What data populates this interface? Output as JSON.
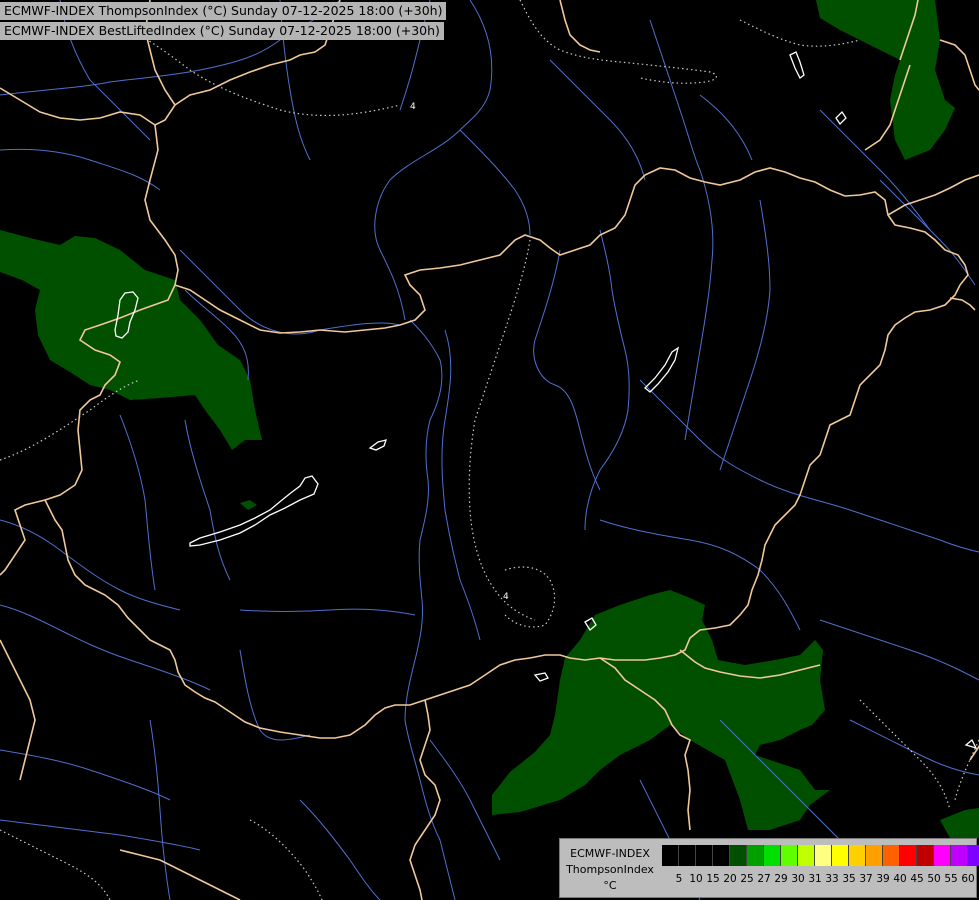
{
  "title_line1": "ECMWF-INDEX ThompsonIndex (°C) Sunday 07-12-2025 18:00 (+30h)",
  "title_line2": "ECMWF-INDEX BestLiftedIndex (°C) Sunday 07-12-2025 18:00 (+30h)",
  "contour_labels": [
    "4",
    "4"
  ],
  "legend": {
    "line1": "ECMWF-INDEX",
    "line2": "ThompsonIndex",
    "line3": "°C",
    "colors": [
      "#000000",
      "#000000",
      "#000000",
      "#000000",
      "#005000",
      "#00a000",
      "#00e000",
      "#60ff00",
      "#c0ff00",
      "#ffff80",
      "#ffff00",
      "#ffd000",
      "#ffa000",
      "#ff6000",
      "#ff0000",
      "#c00000",
      "#ff00ff",
      "#c000ff",
      "#8000ff",
      "#4000ff",
      "#0000ff"
    ],
    "ticks": [
      "5",
      "10",
      "15",
      "20",
      "25",
      "27",
      "29",
      "30",
      "31",
      "33",
      "35",
      "37",
      "39",
      "40",
      "45",
      "50",
      "55",
      "60"
    ]
  },
  "colors": {
    "background": "#000000",
    "border": "#f0c89a",
    "river": "#5070d0",
    "fill_green": "#005000",
    "lake_outline": "#ffffff"
  }
}
